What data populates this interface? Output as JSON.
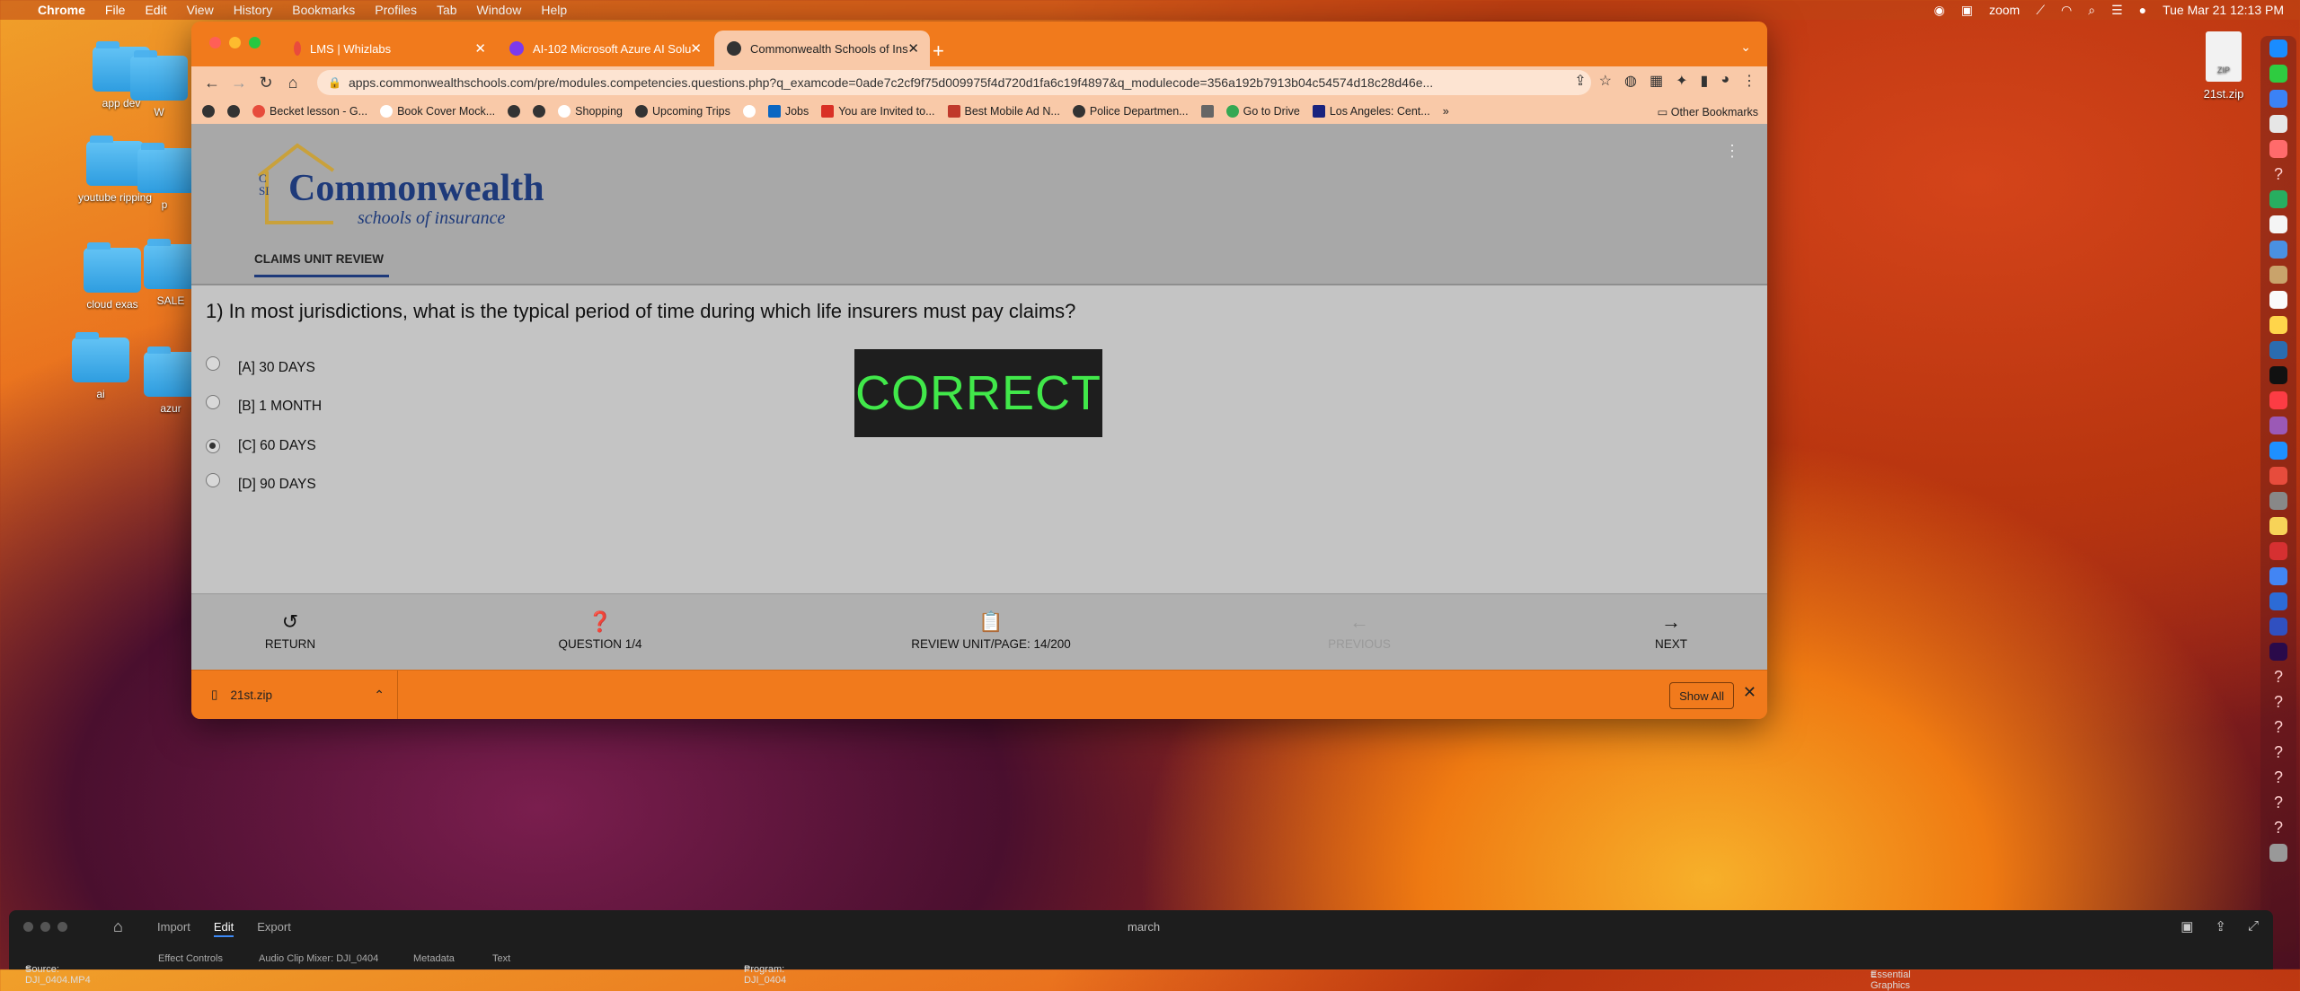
{
  "menubar": {
    "app": "Chrome",
    "items": [
      "File",
      "Edit",
      "View",
      "History",
      "Bookmarks",
      "Profiles",
      "Tab",
      "Window",
      "Help"
    ],
    "zoom": "zoom",
    "datetime": "Tue Mar 21  12:13 PM"
  },
  "desktop": {
    "icons": [
      "app dev",
      "youtube ripping",
      "cloud exas",
      "ai"
    ],
    "partial_labels": [
      "W",
      "p",
      "SALE",
      "azur"
    ],
    "zip_label": "21st.zip",
    "zip_badge": "ZIP"
  },
  "browser": {
    "tabs": [
      {
        "title": "LMS | Whizlabs"
      },
      {
        "title": "AI-102 Microsoft Azure AI Solu"
      },
      {
        "title": "Commonwealth Schools of Ins"
      }
    ],
    "url": "apps.commonwealthschools.com/pre/modules.competencies.questions.php?q_examcode=0ade7c2cf9f75d009975f4d720d1fa6c19f4897&q_modulecode=356a192b7913b04c54574d18c28d46e...",
    "bookmarks": [
      "Becket lesson - G...",
      "Book Cover Mock...",
      "Shopping",
      "Upcoming Trips",
      "Jobs",
      "You are Invited to...",
      "Best Mobile Ad N...",
      "Police Departmen...",
      "Go to Drive",
      "Los Angeles: Cent..."
    ],
    "bookmarks_overflow": "»",
    "other_bookmarks": "Other Bookmarks"
  },
  "site": {
    "logo_main": "Commonwealth",
    "logo_sub": "schools of insurance",
    "logo_letters": "CSI",
    "tab_label": "CLAIMS UNIT REVIEW",
    "question": "1) In most jurisdictions, what is the typical period of time during which life insurers must pay claims?",
    "options": [
      {
        "label": "[A] 30 DAYS",
        "checked": false
      },
      {
        "label": "[B] 1 MONTH",
        "checked": false
      },
      {
        "label": "[C] 60 DAYS",
        "checked": true
      },
      {
        "label": "[D] 90 DAYS",
        "checked": false
      }
    ],
    "result": "CORRECT",
    "nav": {
      "return": "RETURN",
      "question": "QUESTION 1/4",
      "review": "REVIEW UNIT/PAGE: 14/200",
      "previous": "PREVIOUS",
      "next": "NEXT"
    }
  },
  "downloads": {
    "file": "21st.zip",
    "show_all": "Show All"
  },
  "premiere": {
    "menu": [
      "Import",
      "Edit",
      "Export"
    ],
    "project": "march",
    "source": "Source: DJI_0404.MP4",
    "effect_controls": "Effect Controls",
    "audio_mixer": "Audio Clip Mixer: DJI_0404",
    "metadata": "Metadata",
    "text": "Text",
    "program": "Program: DJI_0404",
    "essential": "Essential Graphics"
  },
  "colors": {
    "accent_orange": "#f17a1c",
    "correct_green": "#41e84a",
    "logo_blue": "#1e3a7a"
  }
}
